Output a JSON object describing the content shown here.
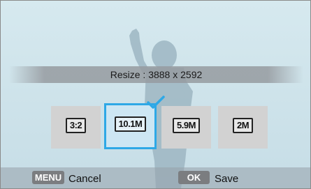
{
  "banner": {
    "text": "Resize : 3888 x 2592"
  },
  "options": [
    {
      "glyph": "3:2",
      "selected": false
    },
    {
      "glyph": "10.1M",
      "selected": true
    },
    {
      "glyph": "5.9M",
      "selected": false
    },
    {
      "glyph": "2M",
      "selected": false
    }
  ],
  "controls": {
    "menu_key": "MENU",
    "cancel_label": "Cancel",
    "ok_key": "OK",
    "save_label": "Save"
  },
  "colors": {
    "accent": "#2ea8e6",
    "background": "#cfe4ec"
  }
}
